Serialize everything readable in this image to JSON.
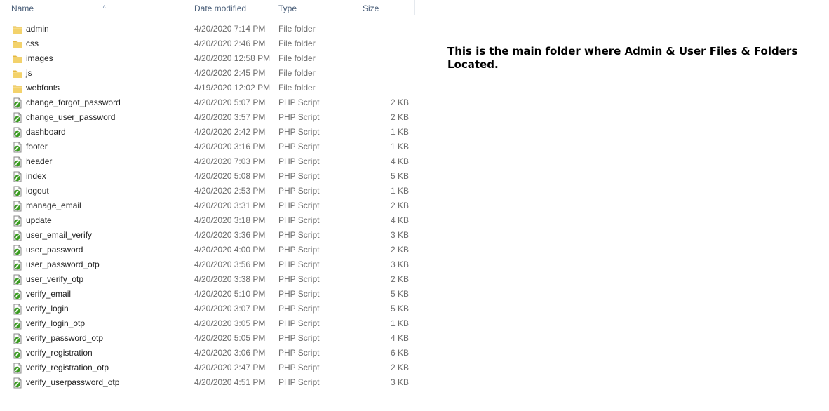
{
  "columns": {
    "name": "Name",
    "date_modified": "Date modified",
    "type": "Type",
    "size": "Size"
  },
  "sort_indicator": "˄",
  "note": "This is the main folder where Admin & User Files & Folders Located.",
  "colors": {
    "header_text": "#4c607a",
    "folder_fill": "#f3d26b",
    "php_green": "#3a9b20"
  },
  "files": [
    {
      "name": "admin",
      "date": "4/20/2020 7:14 PM",
      "type": "File folder",
      "size": "",
      "icon": "folder-icon"
    },
    {
      "name": "css",
      "date": "4/20/2020 2:46 PM",
      "type": "File folder",
      "size": "",
      "icon": "folder-icon"
    },
    {
      "name": "images",
      "date": "4/20/2020 12:58 PM",
      "type": "File folder",
      "size": "",
      "icon": "folder-icon"
    },
    {
      "name": "js",
      "date": "4/20/2020 2:45 PM",
      "type": "File folder",
      "size": "",
      "icon": "folder-icon"
    },
    {
      "name": "webfonts",
      "date": "4/19/2020 12:02 PM",
      "type": "File folder",
      "size": "",
      "icon": "folder-icon"
    },
    {
      "name": "change_forgot_password",
      "date": "4/20/2020 5:07 PM",
      "type": "PHP Script",
      "size": "2 KB",
      "icon": "php-file-icon"
    },
    {
      "name": "change_user_password",
      "date": "4/20/2020 3:57 PM",
      "type": "PHP Script",
      "size": "2 KB",
      "icon": "php-file-icon"
    },
    {
      "name": "dashboard",
      "date": "4/20/2020 2:42 PM",
      "type": "PHP Script",
      "size": "1 KB",
      "icon": "php-file-icon"
    },
    {
      "name": "footer",
      "date": "4/20/2020 3:16 PM",
      "type": "PHP Script",
      "size": "1 KB",
      "icon": "php-file-icon"
    },
    {
      "name": "header",
      "date": "4/20/2020 7:03 PM",
      "type": "PHP Script",
      "size": "4 KB",
      "icon": "php-file-icon"
    },
    {
      "name": "index",
      "date": "4/20/2020 5:08 PM",
      "type": "PHP Script",
      "size": "5 KB",
      "icon": "php-file-icon"
    },
    {
      "name": "logout",
      "date": "4/20/2020 2:53 PM",
      "type": "PHP Script",
      "size": "1 KB",
      "icon": "php-file-icon"
    },
    {
      "name": "manage_email",
      "date": "4/20/2020 3:31 PM",
      "type": "PHP Script",
      "size": "2 KB",
      "icon": "php-file-icon"
    },
    {
      "name": "update",
      "date": "4/20/2020 3:18 PM",
      "type": "PHP Script",
      "size": "4 KB",
      "icon": "php-file-icon"
    },
    {
      "name": "user_email_verify",
      "date": "4/20/2020 3:36 PM",
      "type": "PHP Script",
      "size": "3 KB",
      "icon": "php-file-icon"
    },
    {
      "name": "user_password",
      "date": "4/20/2020 4:00 PM",
      "type": "PHP Script",
      "size": "2 KB",
      "icon": "php-file-icon"
    },
    {
      "name": "user_password_otp",
      "date": "4/20/2020 3:56 PM",
      "type": "PHP Script",
      "size": "3 KB",
      "icon": "php-file-icon"
    },
    {
      "name": "user_verify_otp",
      "date": "4/20/2020 3:38 PM",
      "type": "PHP Script",
      "size": "2 KB",
      "icon": "php-file-icon"
    },
    {
      "name": "verify_email",
      "date": "4/20/2020 5:10 PM",
      "type": "PHP Script",
      "size": "5 KB",
      "icon": "php-file-icon"
    },
    {
      "name": "verify_login",
      "date": "4/20/2020 3:07 PM",
      "type": "PHP Script",
      "size": "5 KB",
      "icon": "php-file-icon"
    },
    {
      "name": "verify_login_otp",
      "date": "4/20/2020 3:05 PM",
      "type": "PHP Script",
      "size": "1 KB",
      "icon": "php-file-icon"
    },
    {
      "name": "verify_password_otp",
      "date": "4/20/2020 5:05 PM",
      "type": "PHP Script",
      "size": "4 KB",
      "icon": "php-file-icon"
    },
    {
      "name": "verify_registration",
      "date": "4/20/2020 3:06 PM",
      "type": "PHP Script",
      "size": "6 KB",
      "icon": "php-file-icon"
    },
    {
      "name": "verify_registration_otp",
      "date": "4/20/2020 2:47 PM",
      "type": "PHP Script",
      "size": "2 KB",
      "icon": "php-file-icon"
    },
    {
      "name": "verify_userpassword_otp",
      "date": "4/20/2020 4:51 PM",
      "type": "PHP Script",
      "size": "3 KB",
      "icon": "php-file-icon"
    }
  ]
}
